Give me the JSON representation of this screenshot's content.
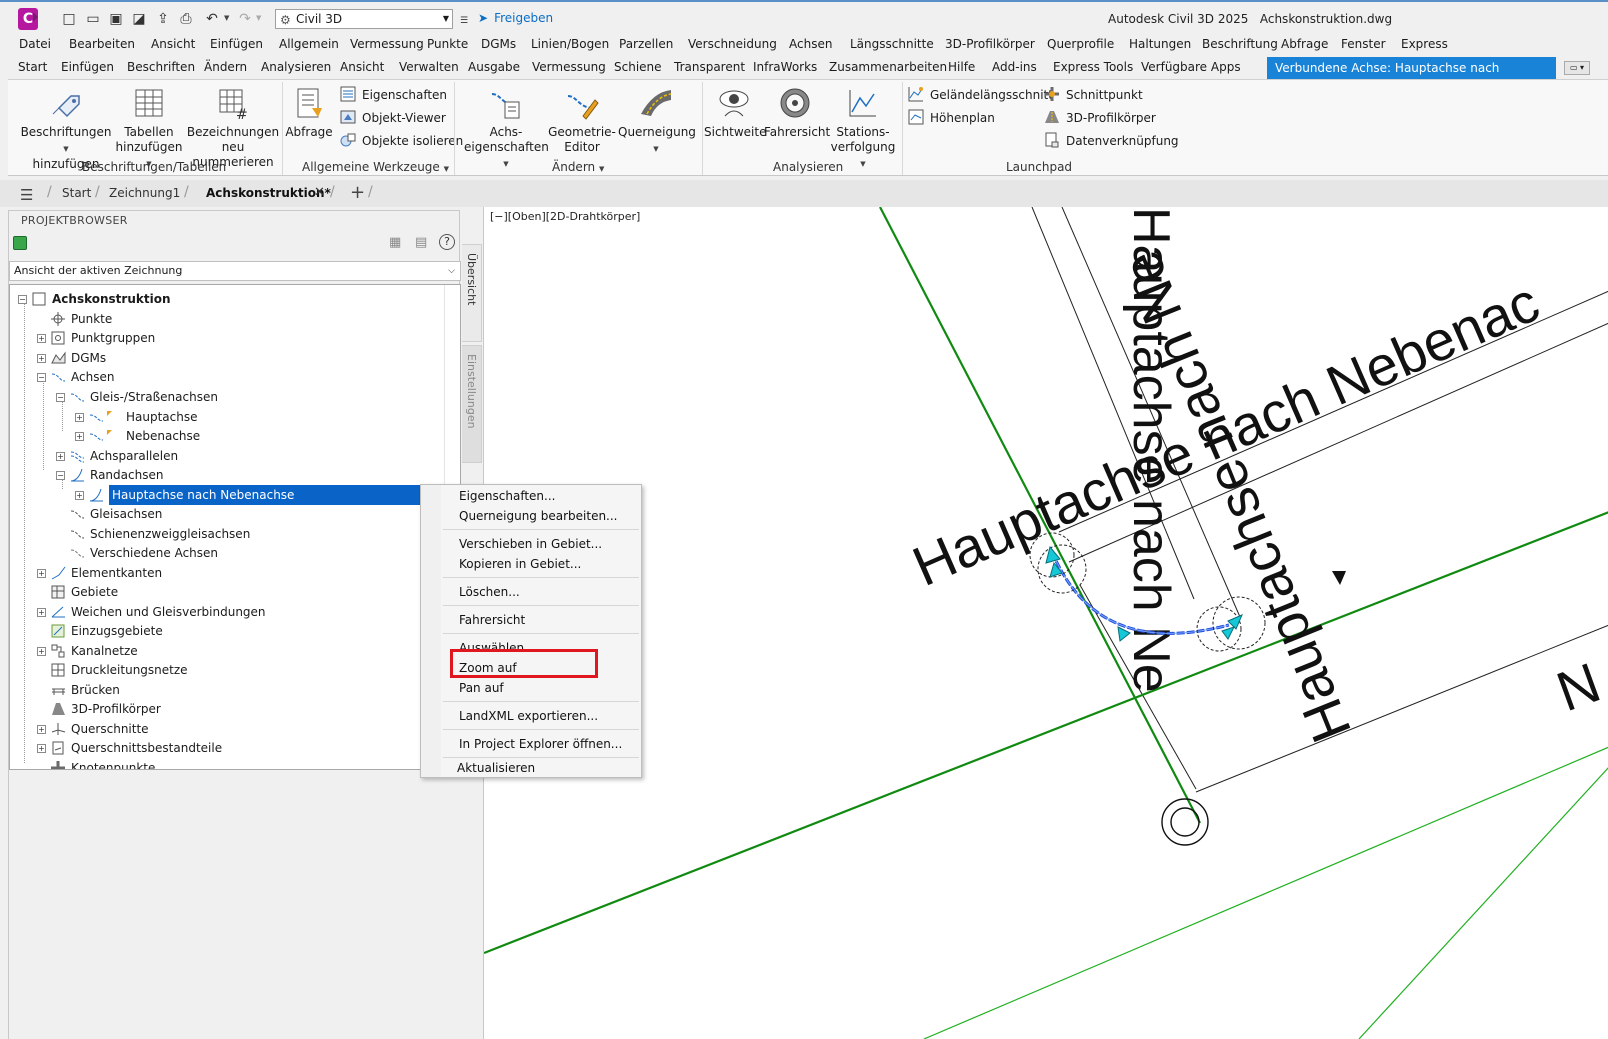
{
  "titlebar": {
    "workspace": "Civil 3D",
    "share_label": "Freigeben",
    "app_title": "Autodesk Civil 3D 2025",
    "file_name": "Achskonstruktion.dwg",
    "app_letter": "C"
  },
  "menubar": [
    "Datei",
    "Bearbeiten",
    "Ansicht",
    "Einfügen",
    "Allgemein",
    "Vermessung",
    "Punkte",
    "DGMs",
    "Linien/Bogen",
    "Parzellen",
    "Verschneidung",
    "Achsen",
    "Längsschnitte",
    "3D-Profilkörper",
    "Querprofile",
    "Haltungen",
    "Beschriftung",
    "Abfrage",
    "Fenster",
    "Express"
  ],
  "ribbon_tabs": [
    "Start",
    "Einfügen",
    "Beschriften",
    "Ändern",
    "Analysieren",
    "Ansicht",
    "Verwalten",
    "Ausgabe",
    "Vermessung",
    "Schiene",
    "Transparent",
    "InfraWorks",
    "Zusammenarbeiten",
    "Hilfe",
    "Add-ins",
    "Express Tools",
    "Verfügbare Apps"
  ],
  "context_tab": "Verbundene Achse: Hauptachse nach Nebenachse",
  "ribbon": {
    "beschriftungen_hinzufuegen": [
      "Beschriftungen",
      "hinzufügen"
    ],
    "tabellen_hinzufuegen": [
      "Tabellen",
      "hinzufügen"
    ],
    "bezeichnungen_neu": [
      "Bezeichnungen",
      "neu nummerieren"
    ],
    "group_beschriftungen": "Beschriftungen/Tabellen",
    "abfrage": "Abfrage",
    "eigenschaften": "Eigenschaften",
    "objekt_viewer": "Objekt-Viewer",
    "objekte_isolieren": "Objekte isolieren",
    "group_allgemein": "Allgemeine Werkzeuge",
    "achs_eigenschaften": [
      "Achs-",
      "eigenschaften"
    ],
    "geometrie_editor": [
      "Geometrie-",
      "Editor"
    ],
    "querneigung": "Querneigung",
    "group_aendern": "Ändern",
    "sichtweite": "Sichtweite",
    "fahrersicht": "Fahrersicht",
    "stationsverfolgung": [
      "Stations-",
      "verfolgung"
    ],
    "group_analysieren": "Analysieren",
    "gelaendelaengsschnitt": "Geländelängsschnitt",
    "hoehenplan": "Höhenplan",
    "schnittpunkt": "Schnittpunkt",
    "profilkoerper": "3D-Profilkörper",
    "datenverknuepfung": "Datenverknüpfung",
    "group_launchpad": "Launchpad"
  },
  "doctabs": {
    "start": "Start",
    "zeichnung1": "Zeichnung1",
    "active": "Achskonstruktion*"
  },
  "projektbrowser": {
    "title": "PROJEKTBROWSER",
    "view_select": "Ansicht der aktiven Zeichnung",
    "side_tabs": [
      "Übersicht",
      "Einstellungen"
    ],
    "tree": {
      "root": "Achskonstruktion",
      "punkte": "Punkte",
      "punktgruppen": "Punktgruppen",
      "dgms": "DGMs",
      "achsen": "Achsen",
      "gleis_strassen": "Gleis-/Straßenachsen",
      "hauptachse": "Hauptachse",
      "nebenachse": "Nebenachse",
      "achsparallelen": "Achsparallelen",
      "randachsen": "Randachsen",
      "selected": "Hauptachse nach Nebenachse",
      "gleisachsen": "Gleisachsen",
      "schienenzweig": "Schienenzweiggleisachsen",
      "verschiedene": "Verschiedene Achsen",
      "elementkanten": "Elementkanten",
      "gebiete": "Gebiete",
      "weichen": "Weichen und Gleisverbindungen",
      "einzugsgebiete": "Einzugsgebiete",
      "kanalnetze": "Kanalnetze",
      "druckleitungsnetze": "Druckleitungsnetze",
      "bruecken": "Brücken",
      "profilkoerper": "3D-Profilkörper",
      "querschnitte": "Querschnitte",
      "querschnittsbestandteile": "Querschnittsbestandteile",
      "knotenpunkte": "Knotenpunkte"
    }
  },
  "viewport": {
    "label": "[−][Oben][2D-Drahtkörper]",
    "text_main": "Hauptachse nach Nebenac",
    "text_vertical": "Hauptachse nach Ne",
    "text_partial": "N",
    "colors": {
      "axis_green": "#108a10",
      "curve_blue": "#1d4fd8",
      "grip_cyan": "#14c8d8"
    }
  },
  "context_menu": {
    "items": [
      "Eigenschaften...",
      "Querneigung bearbeiten...",
      "Verschieben in Gebiet...",
      "Kopieren in Gebiet...",
      "Löschen...",
      "Fahrersicht",
      "Auswählen",
      "Zoom auf",
      "Pan auf",
      "LandXML exportieren...",
      "In Project Explorer öffnen...",
      "Aktualisieren"
    ],
    "highlighted": "Auswählen",
    "highlight_color": "#e0171e"
  }
}
